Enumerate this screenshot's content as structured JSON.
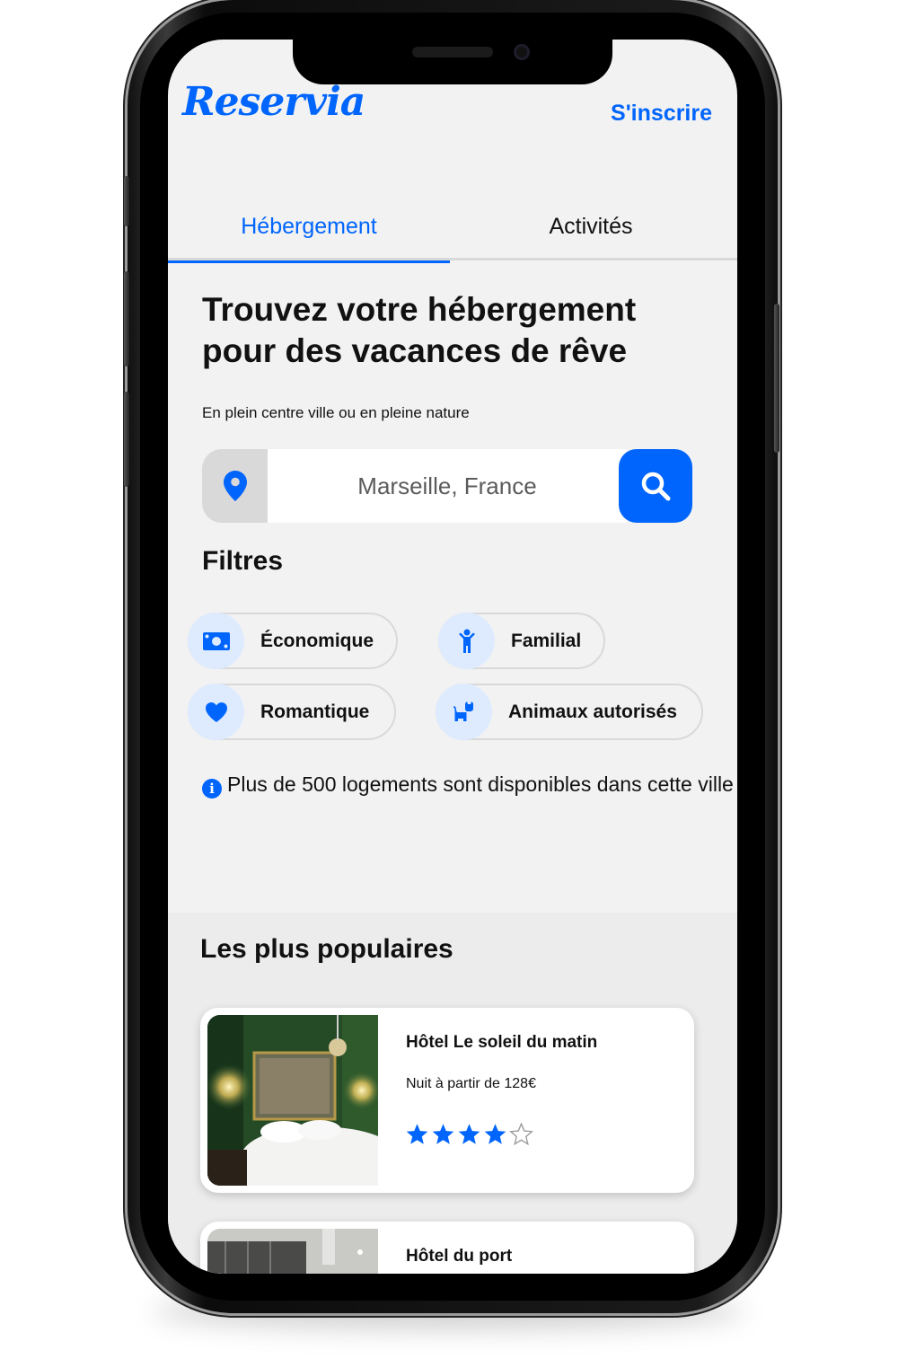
{
  "app": {
    "logo": "Reservia",
    "signup_label": "S'inscrire",
    "accent_color": "#0065fc"
  },
  "tabs": [
    {
      "label": "Hébergement",
      "active": true
    },
    {
      "label": "Activités",
      "active": false
    }
  ],
  "hero": {
    "headline_line1": "Trouvez votre hébergement",
    "headline_line2": "pour des vacances de rêve",
    "subtitle": "En plein centre ville ou en pleine nature"
  },
  "search": {
    "location_icon": "map-pin-icon",
    "placeholder": "Marseille, France",
    "button_icon": "search-icon"
  },
  "filters": {
    "title": "Filtres",
    "items": [
      {
        "label": "Économique",
        "icon": "money-bill-icon"
      },
      {
        "label": "Familial",
        "icon": "child-icon"
      },
      {
        "label": "Romantique",
        "icon": "heart-icon"
      },
      {
        "label": "Animaux autorisés",
        "icon": "dog-icon"
      }
    ]
  },
  "info": {
    "icon": "info-icon",
    "text": "Plus de 500 logements sont disponibles dans cette ville"
  },
  "popular": {
    "title": "Les plus populaires",
    "cards": [
      {
        "name": "Hôtel Le soleil du matin",
        "price": "Nuit à partir de 128€",
        "rating": 4,
        "max_rating": 5
      },
      {
        "name": "Hôtel du port"
      }
    ]
  }
}
